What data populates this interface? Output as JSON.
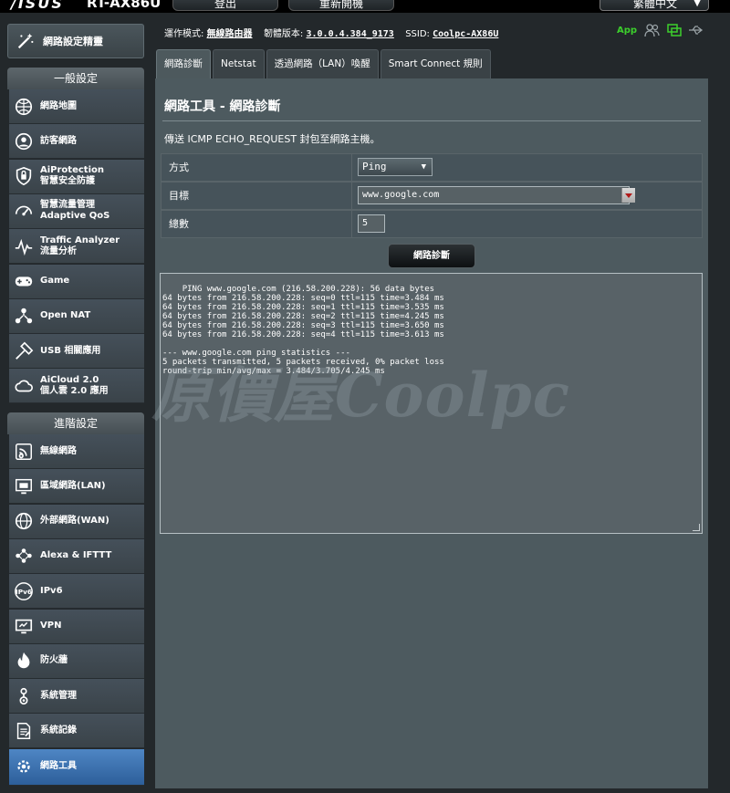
{
  "header": {
    "brand": "/ISUS",
    "model": "RT-AX86U",
    "logout_label": "登出",
    "reboot_label": "重新開機",
    "language_label": "繁體中文"
  },
  "status": {
    "mode_label": "運作模式:",
    "mode_value": "無線路由器",
    "firmware_label": "韌體版本:",
    "firmware_value": "3.0.0.4.384_9173",
    "ssid_label": "SSID:",
    "ssid_value": "Coolpc-AX86U",
    "app_label": "App"
  },
  "sidebar": {
    "qis_label": "網路設定精靈",
    "general_header": "一般設定",
    "advanced_header": "進階設定",
    "general_items": [
      {
        "line1": "網路地圖",
        "line2": ""
      },
      {
        "line1": "訪客網路",
        "line2": ""
      },
      {
        "line1": "AiProtection",
        "line2": "智慧安全防護"
      },
      {
        "line1": "智慧流量管理",
        "line2": "Adaptive QoS"
      },
      {
        "line1": "Traffic Analyzer",
        "line2": "流量分析"
      },
      {
        "line1": "Game",
        "line2": ""
      },
      {
        "line1": "Open NAT",
        "line2": ""
      },
      {
        "line1": "USB 相關應用",
        "line2": ""
      },
      {
        "line1": "AiCloud 2.0",
        "line2": "個人雲 2.0 應用"
      }
    ],
    "advanced_items": [
      {
        "line1": "無線網路"
      },
      {
        "line1": "區域網路(LAN)"
      },
      {
        "line1": "外部網路(WAN)"
      },
      {
        "line1": "Alexa & IFTTT"
      },
      {
        "line1": "IPv6"
      },
      {
        "line1": "VPN"
      },
      {
        "line1": "防火牆"
      },
      {
        "line1": "系統管理"
      },
      {
        "line1": "系統記錄"
      },
      {
        "line1": "網路工具"
      }
    ]
  },
  "tabs": [
    "網路診斷",
    "Netstat",
    "透過網路（LAN）喚醒",
    "Smart Connect 規則"
  ],
  "main": {
    "title": "網路工具 - 網路診斷",
    "description": "傳送 ICMP ECHO_REQUEST 封包至網路主機。",
    "method_label": "方式",
    "method_value": "Ping",
    "target_label": "目標",
    "target_value": "www.google.com",
    "count_label": "總數",
    "count_value": "5",
    "diagnose_button": "網路診斷",
    "output": "PING www.google.com (216.58.200.228): 56 data bytes\n64 bytes from 216.58.200.228: seq=0 ttl=115 time=3.484 ms\n64 bytes from 216.58.200.228: seq=1 ttl=115 time=3.535 ms\n64 bytes from 216.58.200.228: seq=2 ttl=115 time=4.245 ms\n64 bytes from 216.58.200.228: seq=3 ttl=115 time=3.650 ms\n64 bytes from 216.58.200.228: seq=4 ttl=115 time=3.613 ms\n\n--- www.google.com ping statistics ---\n5 packets transmitted, 5 packets received, 0% packet loss\nround-trip min/avg/max = 3.484/3.705/4.245 ms"
  },
  "watermark": "原價屋Coolpc",
  "colors": {
    "app_green": "#3ccf2c",
    "active_menu": "#3a6fae",
    "panel_bg": "#4d5a5f"
  },
  "icons": [
    "wizard-icon",
    "network-map-icon",
    "guest-network-icon",
    "aiprotection-icon",
    "qos-icon",
    "traffic-analyzer-icon",
    "game-icon",
    "open-nat-icon",
    "usb-icon",
    "aicloud-icon",
    "wireless-icon",
    "lan-icon",
    "wan-icon",
    "alexa-icon",
    "ipv6-icon",
    "vpn-icon",
    "firewall-icon",
    "administration-icon",
    "system-log-icon",
    "network-tools-icon"
  ]
}
